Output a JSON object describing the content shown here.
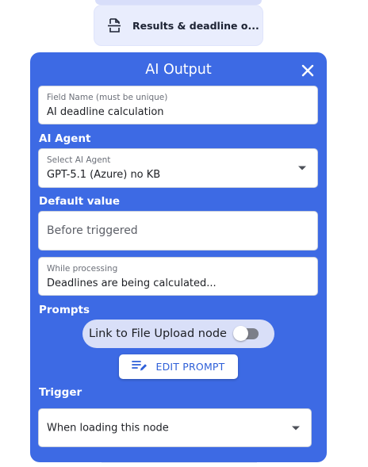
{
  "node": {
    "label": "Results & deadline o...",
    "icon": "document-scan-icon"
  },
  "panel": {
    "title": "AI Output",
    "close_icon": "close-icon"
  },
  "field_name": {
    "label": "Field Name (must be unique)",
    "value": "AI deadline calculation"
  },
  "ai_agent": {
    "section": "AI Agent",
    "label": "Select AI Agent",
    "value": "GPT-5.1 (Azure) no KB"
  },
  "default_value": {
    "section": "Default value",
    "before_triggered_placeholder": "Before triggered",
    "while_processing_label": "While processing",
    "while_processing_value": "Deadlines are being calculated..."
  },
  "prompts": {
    "section": "Prompts",
    "toggle_label": "Link to File Upload node",
    "toggle_on": false,
    "edit_button": "EDIT PROMPT"
  },
  "trigger": {
    "section": "Trigger",
    "value": "When loading this node"
  },
  "colors": {
    "panel_bg": "#3d6ae4",
    "accent": "#2d5fd8",
    "node_bg": "#e9edfd"
  }
}
